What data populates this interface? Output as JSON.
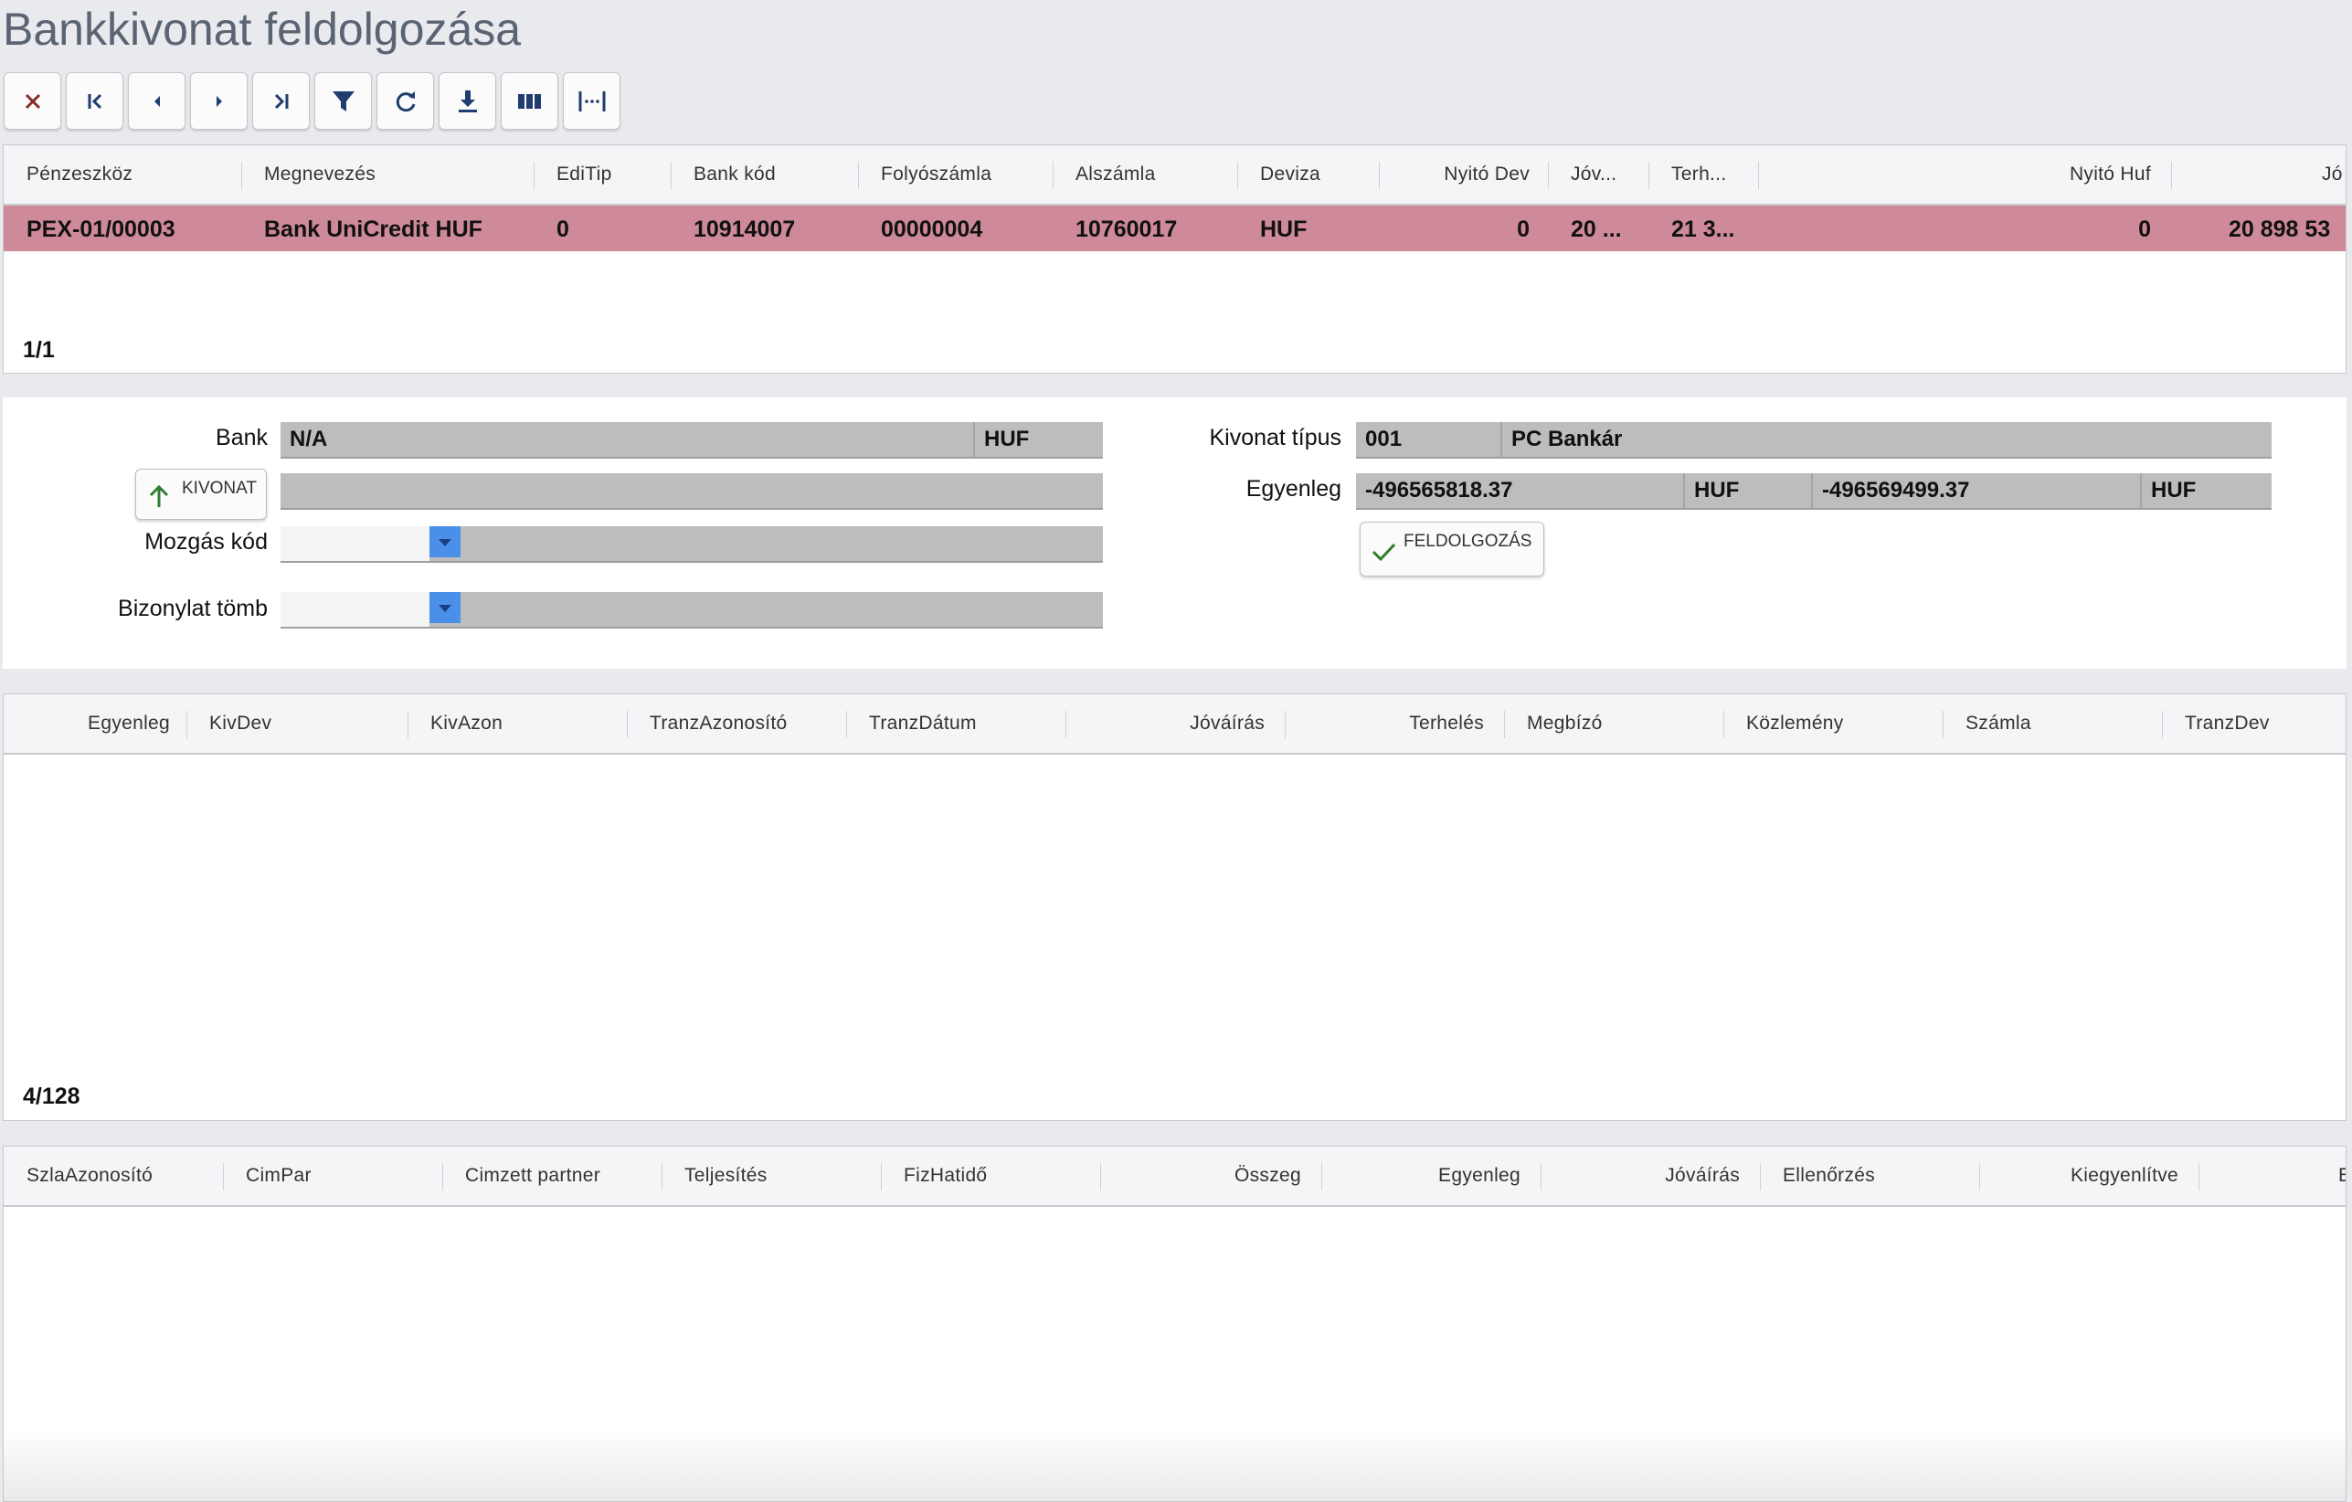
{
  "page": {
    "title": "Bankkivonat feldolgozása"
  },
  "toolbar": {
    "buttons": [
      {
        "icon": "close-icon",
        "color": "#8b2a2a"
      },
      {
        "icon": "first-record-icon",
        "color": "#1f3d6e"
      },
      {
        "icon": "prev-record-icon",
        "color": "#1f3d6e"
      },
      {
        "icon": "next-record-icon",
        "color": "#1f3d6e"
      },
      {
        "icon": "last-record-icon",
        "color": "#1f3d6e"
      },
      {
        "icon": "filter-icon",
        "color": "#1f3d6e"
      },
      {
        "icon": "refresh-icon",
        "color": "#1f3d6e"
      },
      {
        "icon": "download-icon",
        "color": "#1f3d6e"
      },
      {
        "icon": "columns-icon",
        "color": "#1f3d6e"
      },
      {
        "icon": "column-width-icon",
        "color": "#1f3d6e"
      }
    ]
  },
  "accounts_grid": {
    "columns": [
      "Pénzeszköz",
      "Megnevezés",
      "EdiTip",
      "Bank kód",
      "Folyószámla",
      "Alszámla",
      "Deviza",
      "Nyitó Dev",
      "Jóv...",
      "Terh...",
      "Nyitó Huf",
      "Jó"
    ],
    "rows": [
      [
        "PEX-01/00003",
        "Bank UniCredit HUF",
        "0",
        "10914007",
        "00000004",
        "10760017",
        "HUF",
        "0",
        "20 ...",
        "21 3...",
        "0",
        "20 898 53"
      ]
    ],
    "selected_row_color": "#cf8a9a",
    "record_count": "1/1"
  },
  "form": {
    "bank_label": "Bank",
    "bank_value": "N/A",
    "bank_currency": "HUF",
    "kivonat_button": "KIVONAT",
    "kivonat_value": "",
    "mozgas_label": "Mozgás kód",
    "mozgas_value": "",
    "bizonylat_label": "Bizonylat tömb",
    "bizonylat_value": "",
    "kivonat_tipus_label": "Kivonat típus",
    "kivonat_tipus_code": "001",
    "kivonat_tipus_name": "PC Bankár",
    "egyenleg_label": "Egyenleg",
    "egyenleg_value1": "-496565818.37",
    "egyenleg_currency1": "HUF",
    "egyenleg_value2": "-496569499.37",
    "egyenleg_currency2": "HUF",
    "feldolgozas_button": "FELDOLGOZÁS"
  },
  "transactions_grid": {
    "columns": [
      "Egyenleg",
      "KivDev",
      "KivAzon",
      "TranzAzonosító",
      "TranzDátum",
      "Jóváírás",
      "Terhelés",
      "Megbízó",
      "Közlemény",
      "Számla",
      "TranzDev"
    ],
    "record_count": "4/128"
  },
  "invoices_grid": {
    "columns": [
      "SzlaAzonosító",
      "CimPar",
      "Cimzett partner",
      "Teljesítés",
      "FizHatidő",
      "Összeg",
      "Egyenleg",
      "Jóváírás",
      "Ellenőrzés",
      "Kiegyenlítve",
      "E"
    ]
  }
}
